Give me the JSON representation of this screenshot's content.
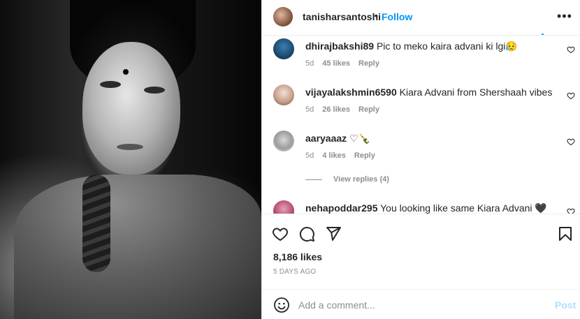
{
  "post": {
    "author": "tanisharsantoshi",
    "separator": "•",
    "follow_label": "Follow",
    "more_label": "•••",
    "likes": "8,186 likes",
    "timestamp": "5 DAYS AGO",
    "photo_alt": "Black and white portrait of a woman"
  },
  "comments": [
    {
      "user": "dhirajbakshi89",
      "text": "Pic to meko kaira advani ki lgi😥",
      "age": "5d",
      "likes": "45 likes",
      "reply": "Reply"
    },
    {
      "user": "vijayalakshmin6590",
      "text": "Kiara Advani from Shershaah vibes",
      "age": "5d",
      "likes": "26 likes",
      "reply": "Reply"
    },
    {
      "user": "aaryaaaz",
      "text": "♡🍾",
      "age": "5d",
      "likes": "4 likes",
      "reply": "Reply"
    },
    {
      "user": "nehapoddar295",
      "text": "You looking like same Kiara Advani 🖤💌"
    }
  ],
  "view_replies": "View replies (4)",
  "composer": {
    "placeholder": "Add a comment...",
    "post_label": "Post"
  },
  "icons": {
    "like": "heart-icon",
    "comment": "comment-icon",
    "share": "paper-plane-icon",
    "save": "bookmark-icon",
    "emoji": "smiley-icon",
    "more": "more-dots-icon"
  },
  "colors": {
    "link": "#0095f6",
    "post_disabled": "#b2dffc",
    "muted": "#8e8e8e",
    "text": "#262626"
  }
}
